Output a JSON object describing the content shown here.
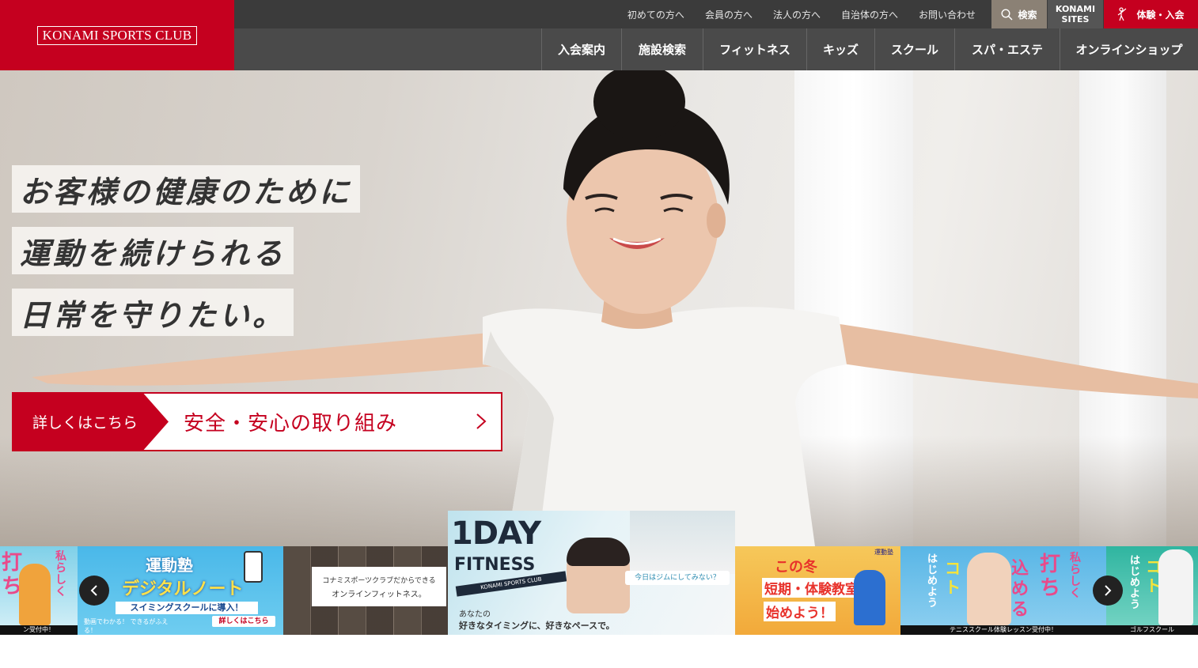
{
  "header": {
    "logo": "KONAMI SPORTS CLUB",
    "utility_links": [
      "初めての方へ",
      "会員の方へ",
      "法人の方へ",
      "自治体の方へ",
      "お問い合わせ"
    ],
    "search_label": "検索",
    "sites_label_line1": "KONAMI",
    "sites_label_line2": "SITES",
    "trial_label": "体験・入会",
    "nav_items": [
      "入会案内",
      "施設検索",
      "フィットネス",
      "キッズ",
      "スクール",
      "スパ・エステ",
      "オンラインショップ"
    ]
  },
  "hero": {
    "lines": [
      "お客様の健康のために",
      "運動を続けられる",
      "日常を守りたい。"
    ],
    "cta_tag": "詳しくはこちら",
    "cta_text": "安全・安心の取り組み"
  },
  "carousel": {
    "banner_left_partial": {
      "big": "打ち",
      "side": "私らしく",
      "strip": "ン受付中！"
    },
    "banner_digital": {
      "top": "運動塾",
      "title": "デジタルノート",
      "sub": "スイミングスクールに導入！",
      "link": "詳しくはこちら",
      "tiny": "動画でわかる！ できるがふえる！"
    },
    "banner_online": {
      "line1": "コナミスポーツクラブだからできる",
      "line2": "オンラインフィットネス。"
    },
    "banner_main": {
      "title1": "1DAY",
      "title2": "FITNESS",
      "ribbon": "KONAMI SPORTS CLUB",
      "bubble": "今日はジムにしてみない？",
      "sub1": "あなたの",
      "sub2": "好きなタイミングに、好きなペースで。"
    },
    "banner_winter": {
      "line1": "この冬",
      "line2": "短期・体験教室",
      "line3": "始めよう！",
      "badge": "運動塾"
    },
    "banner_tennis": {
      "big1": "打ち",
      "big2": "込める",
      "side1": "はじめよう",
      "side2": "私らしく",
      "koto": "コト",
      "strip": "テニススクール体験レッスン受付中！"
    },
    "banner_golf_partial": {
      "side": "はじめよう",
      "koto": "コト",
      "strip": "ゴルフスクール"
    }
  },
  "colors": {
    "brand_red": "#c5001f",
    "header_dark": "#3b3b3b",
    "nav_dark": "#4a4a4a",
    "search_bg": "#8b8175"
  }
}
